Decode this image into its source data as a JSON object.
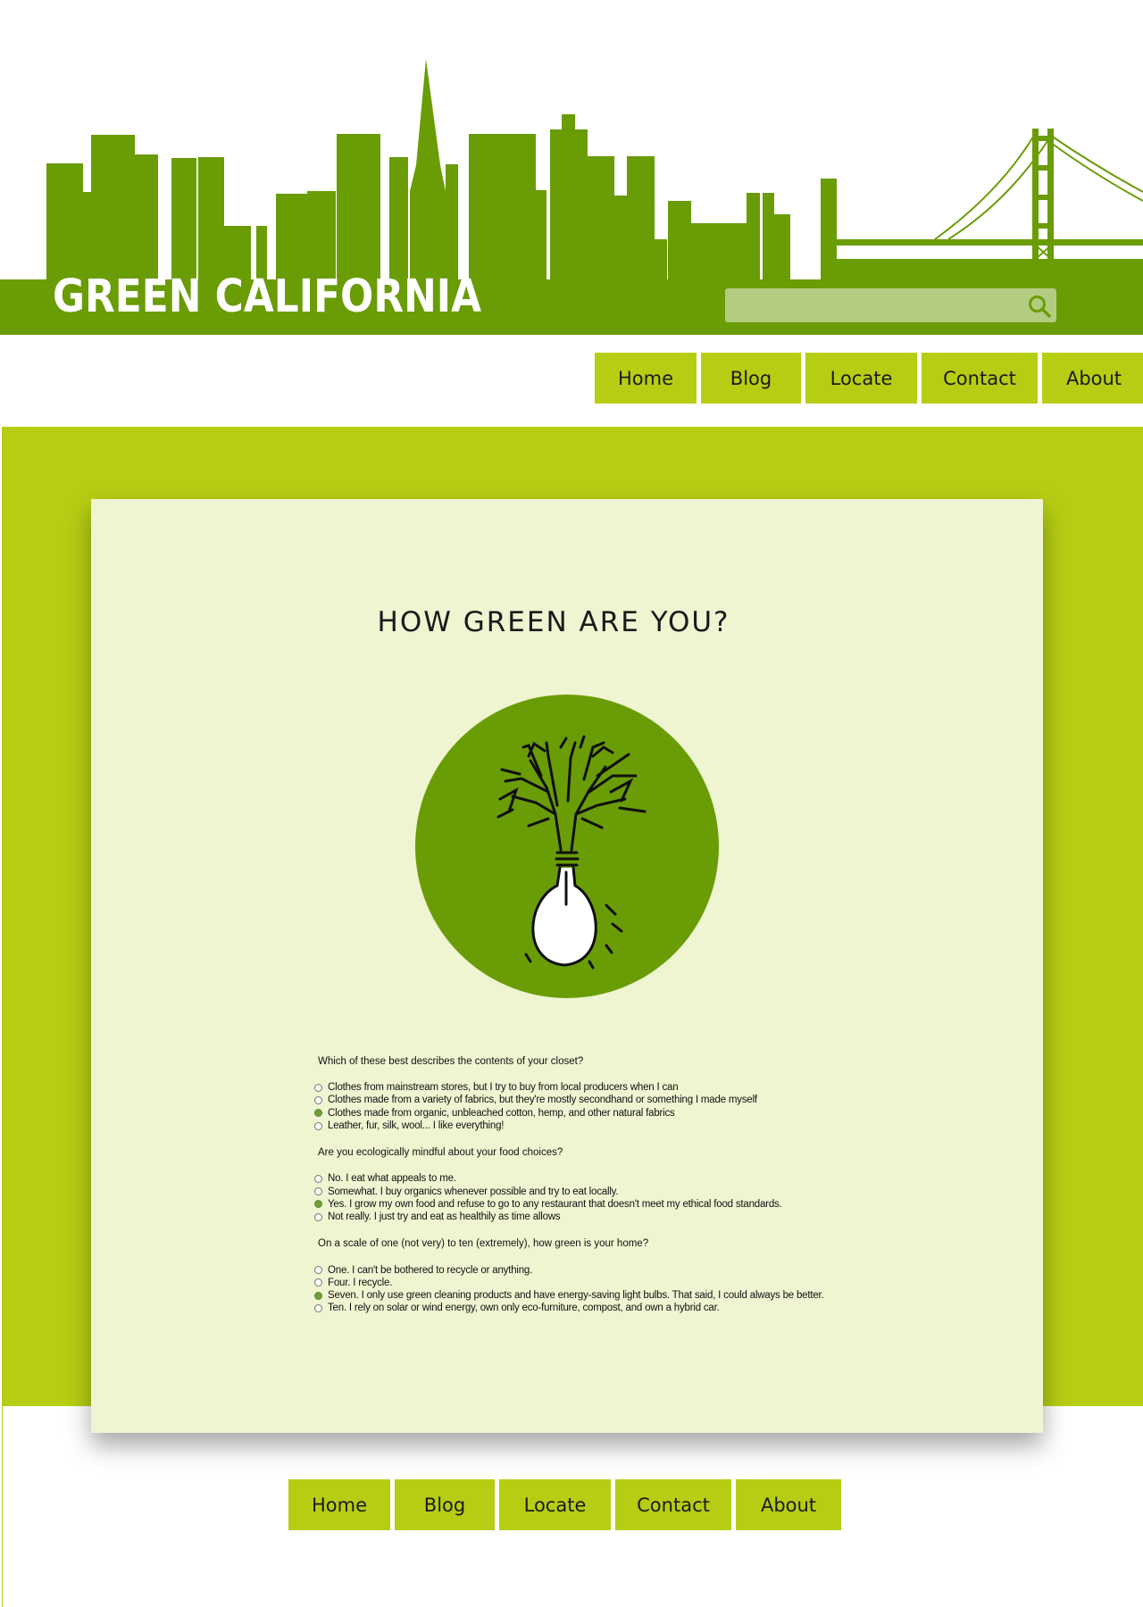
{
  "site": {
    "title": "GREEN CALIFORNIA",
    "search": {
      "placeholder": ""
    },
    "colors": {
      "header_green": "#6a9c06",
      "accent_lime": "#b7cd13",
      "card_bg": "#eff4d1",
      "search_bg": "#b2cd82"
    }
  },
  "nav_top": [
    "Home",
    "Blog",
    "Locate",
    "Contact",
    "About"
  ],
  "nav_bottom": [
    "Home",
    "Blog",
    "Locate",
    "Contact",
    "About"
  ],
  "quiz": {
    "title": "HOW GREEN ARE YOU?",
    "emblem": "tree-lightbulb-icon",
    "questions": [
      {
        "text": "Which of these best describes the contents of your closet?",
        "options": [
          {
            "label": "Clothes from mainstream stores, but I try to buy from local producers when I can",
            "checked": false
          },
          {
            "label": "Clothes made from a variety of fabrics, but they're mostly secondhand or something I made myself",
            "checked": false
          },
          {
            "label": "Clothes made from organic, unbleached cotton, hemp, and other natural fabrics",
            "checked": true
          },
          {
            "label": "Leather, fur, silk, wool... I like everything!",
            "checked": false
          }
        ]
      },
      {
        "text": "Are you ecologically mindful about your food choices?",
        "options": [
          {
            "label": "No. I eat what appeals to me.",
            "checked": false
          },
          {
            "label": "Somewhat. I buy organics whenever possible and try to eat locally.",
            "checked": false
          },
          {
            "label": "Yes. I grow my own food and refuse to go to any restaurant that doesn't meet my ethical food standards.",
            "checked": true
          },
          {
            "label": "Not really. I just try and eat as healthily as time allows",
            "checked": false
          }
        ]
      },
      {
        "text": "On a scale of one (not very) to ten (extremely), how green is your home?",
        "options": [
          {
            "label": "One. I can't be bothered to recycle or anything.",
            "checked": false
          },
          {
            "label": "Four. I recycle.",
            "checked": false
          },
          {
            "label": "Seven. I only use green cleaning products and have energy-saving light bulbs. That said, I could always be better.",
            "checked": true
          },
          {
            "label": "Ten. I rely on solar or wind energy, own only eco-furniture, compost, and own a hybrid car.",
            "checked": false
          }
        ]
      }
    ]
  }
}
